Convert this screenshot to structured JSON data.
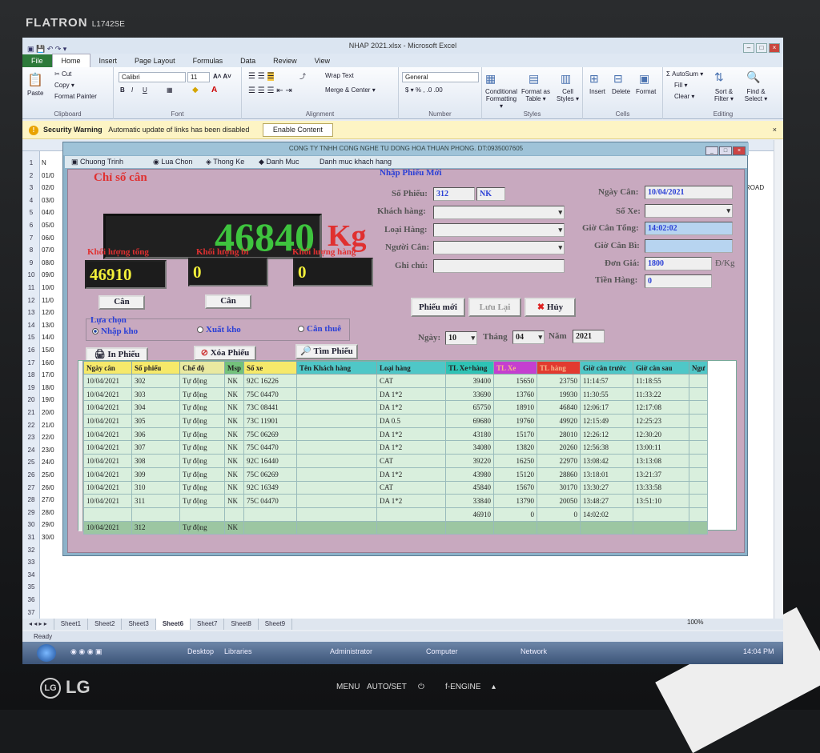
{
  "monitor": {
    "brand": "FLATRON",
    "model": "L1742SE",
    "maker": "LG",
    "buttons": [
      "MENU",
      "AUTO/SET",
      "⏻",
      "f-ENGINE",
      "▴"
    ]
  },
  "excel": {
    "title": "NHAP 2021.xlsx - Microsoft Excel",
    "tabs": [
      "File",
      "Home",
      "Insert",
      "Page Layout",
      "Formulas",
      "Data",
      "Review",
      "View"
    ],
    "clipboard": {
      "paste": "Paste",
      "cut": "Cut",
      "copy": "Copy ▾",
      "format_painter": "Format Painter",
      "group": "Clipboard"
    },
    "font": {
      "name": "Calibri",
      "size": "11",
      "group": "Font"
    },
    "alignment": {
      "wrap": "Wrap Text",
      "merge": "Merge & Center ▾",
      "group": "Alignment"
    },
    "number": {
      "format": "General",
      "group": "Number"
    },
    "styles": {
      "cond": "Conditional Formatting ▾",
      "table": "Format as Table ▾",
      "cell": "Cell Styles ▾",
      "group": "Styles"
    },
    "cells": {
      "insert": "Insert",
      "delete": "Delete",
      "format": "Format",
      "group": "Cells"
    },
    "editing": {
      "autosum": "Σ AutoSum ▾",
      "fill": "Fill ▾",
      "clear": "Clear ▾",
      "sort": "Sort & Filter ▾",
      "find": "Find & Select ▾",
      "group": "Editing"
    },
    "security": {
      "label": "Security Warning",
      "message": "Automatic update of links has been disabled",
      "button": "Enable Content"
    },
    "rows": [
      "1",
      "2",
      "3",
      "4",
      "5",
      "6",
      "7",
      "8",
      "9",
      "10",
      "11",
      "12",
      "13",
      "14",
      "15",
      "16",
      "17",
      "18",
      "19",
      "20",
      "21",
      "22",
      "23",
      "24",
      "25",
      "26",
      "27",
      "28",
      "29",
      "30",
      "31",
      "32",
      "33",
      "34",
      "35",
      "36",
      "37"
    ],
    "row_text": [
      "N",
      "01/0",
      "02/0",
      "03/0",
      "04/0",
      "05/0",
      "06/0",
      "07/0",
      "08/0",
      "09/0",
      "10/0",
      "11/0",
      "12/0",
      "13/0",
      "14/0",
      "15/0",
      "16/0",
      "17/0",
      "18/0",
      "19/0",
      "20/0",
      "21/0",
      "22/0",
      "23/0",
      "24/0",
      "25/0",
      "26/0",
      "27/0",
      "28/0",
      "29/0",
      "30/0"
    ],
    "right_cell": "ROAD",
    "sheets": [
      "Sheet1",
      "Sheet2",
      "Sheet3",
      "Sheet6",
      "Sheet7",
      "Sheet8",
      "Sheet9"
    ],
    "active_sheet": "Sheet6",
    "status": "Ready",
    "zoom": "100%",
    "taskbar": {
      "desktop": "Desktop",
      "libraries": "Libraries",
      "admin": "Administrator",
      "computer": "Computer",
      "network": "Network",
      "time": "14:04 PM"
    }
  },
  "app": {
    "title": "CONG TY TNHH CONG NGHE TU DONG HOA THUAN PHONG. DT:0935007605",
    "menu": [
      "Chuong Trinh",
      "Lua Chon",
      "Thong Ke",
      "Danh Muc",
      "Danh muc khach hang"
    ],
    "chi_so_can": "Chỉ số cân",
    "weight": "46840",
    "unit": "Kg",
    "kl_tong_label": "Khối lượng tổng",
    "kl_bi_label": "Khối lượng bì",
    "kl_hang_label": "Khối lượng hàng",
    "kl_tong": "46910",
    "kl_bi": "0",
    "kl_hang": "0",
    "can_btn": "Cân",
    "lua_chon": "Lựa chọn",
    "nhap_kho": "Nhập kho",
    "xuat_kho": "Xuất kho",
    "can_thue": "Cân thuê",
    "in_phieu": "In Phiếu",
    "xoa_phieu": "Xóa Phiếu",
    "tim_phieu": "Tìm Phiếu",
    "nhap_phieu_moi": "Nhập Phiếu Mới",
    "so_phieu_label": "Số Phiếu:",
    "so_phieu": "312",
    "so_phieu_type": "NK",
    "khach_hang_label": "Khách hàng:",
    "loai_hang_label": "Loại Hàng:",
    "nguoi_can_label": "Người Cân:",
    "ghi_chu_label": "Ghi chú:",
    "ngay_can_label": "Ngày Cân:",
    "ngay_can": "10/04/2021",
    "so_xe_label": "Số Xe:",
    "gio_can_tong_label": "Giờ Cân Tổng:",
    "gio_can_tong": "14:02:02",
    "gio_can_bi_label": "Giờ Cân Bì:",
    "don_gia_label": "Đơn Giá:",
    "don_gia": "1800",
    "don_gia_unit": "Đ/Kg",
    "tien_hang_label": "Tiền Hàng:",
    "tien_hang": "0",
    "phieu_moi": "Phiếu mới",
    "luu_lai": "Lưu Lại",
    "huy": "Hủy",
    "ngay_label": "Ngày:",
    "ngay": "10",
    "thang_label": "Tháng",
    "thang": "04",
    "nam_label": "Năm",
    "nam": "2021",
    "columns": [
      "Ngày cân",
      "Số phiếu",
      "Chế độ",
      "Msp",
      "Số xe",
      "Tên Khách hàng",
      "Loại hàng",
      "TL Xe+hàng",
      "TL Xe",
      "TL hàng",
      "Giờ cân trước",
      "Giờ cân sau",
      "Ngư"
    ],
    "rows": [
      [
        "10/04/2021",
        "302",
        "Tự động",
        "NK",
        "92C 16226",
        "",
        "CAT",
        "39400",
        "15650",
        "23750",
        "11:14:57",
        "11:18:55",
        ""
      ],
      [
        "10/04/2021",
        "303",
        "Tự động",
        "NK",
        "75C 04470",
        "",
        "DA 1*2",
        "33690",
        "13760",
        "19930",
        "11:30:55",
        "11:33:22",
        ""
      ],
      [
        "10/04/2021",
        "304",
        "Tự động",
        "NK",
        "73C 08441",
        "",
        "DA 1*2",
        "65750",
        "18910",
        "46840",
        "12:06:17",
        "12:17:08",
        ""
      ],
      [
        "10/04/2021",
        "305",
        "Tự động",
        "NK",
        "73C 11901",
        "",
        "DA 0.5",
        "69680",
        "19760",
        "49920",
        "12:15:49",
        "12:25:23",
        ""
      ],
      [
        "10/04/2021",
        "306",
        "Tự động",
        "NK",
        "75C 06269",
        "",
        "DA 1*2",
        "43180",
        "15170",
        "28010",
        "12:26:12",
        "12:30:20",
        ""
      ],
      [
        "10/04/2021",
        "307",
        "Tự động",
        "NK",
        "75C 04470",
        "",
        "DA 1*2",
        "34080",
        "13820",
        "20260",
        "12:56:38",
        "13:00:11",
        ""
      ],
      [
        "10/04/2021",
        "308",
        "Tự động",
        "NK",
        "92C 16440",
        "",
        "CAT",
        "39220",
        "16250",
        "22970",
        "13:08:42",
        "13:13:08",
        ""
      ],
      [
        "10/04/2021",
        "309",
        "Tự động",
        "NK",
        "75C 06269",
        "",
        "DA 1*2",
        "43980",
        "15120",
        "28860",
        "13:18:01",
        "13:21:37",
        ""
      ],
      [
        "10/04/2021",
        "310",
        "Tự động",
        "NK",
        "92C 16349",
        "",
        "CAT",
        "45840",
        "15670",
        "30170",
        "13:30:27",
        "13:33:58",
        ""
      ],
      [
        "10/04/2021",
        "311",
        "Tự động",
        "NK",
        "75C 04470",
        "",
        "DA 1*2",
        "33840",
        "13790",
        "20050",
        "13:48:27",
        "13:51:10",
        ""
      ],
      [
        "",
        "",
        "",
        "",
        "",
        "",
        "",
        "46910",
        "0",
        "0",
        "14:02:02",
        "",
        ""
      ],
      [
        "10/04/2021",
        "312",
        "Tự động",
        "NK",
        "",
        "",
        "",
        "",
        "",
        "",
        "",
        "",
        ""
      ]
    ]
  }
}
